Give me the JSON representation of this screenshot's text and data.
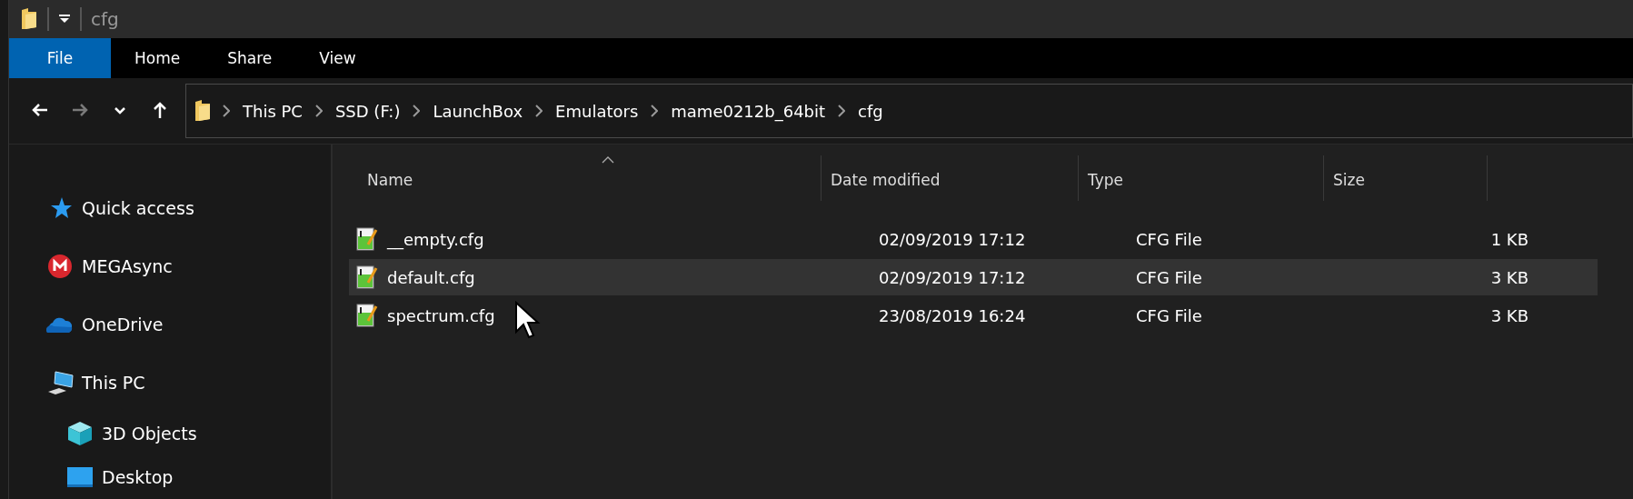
{
  "window": {
    "title": "cfg"
  },
  "ribbon_tabs": [
    {
      "label": "File",
      "kind": "file-menu"
    },
    {
      "label": "Home",
      "kind": "tab"
    },
    {
      "label": "Share",
      "kind": "tab"
    },
    {
      "label": "View",
      "kind": "tab"
    }
  ],
  "nav_buttons": [
    {
      "kind": "back",
      "disabled": false
    },
    {
      "kind": "forward",
      "disabled": true
    },
    {
      "kind": "recent",
      "disabled": false
    },
    {
      "kind": "up",
      "disabled": false
    }
  ],
  "breadcrumb": [
    "This PC",
    "SSD (F:)",
    "LaunchBox",
    "Emulators",
    "mame0212b_64bit",
    "cfg"
  ],
  "sidebar": {
    "items": [
      {
        "label": "Quick access",
        "kind": "star"
      },
      {
        "label": "MEGAsync",
        "kind": "mega"
      },
      {
        "label": "OneDrive",
        "kind": "cloud"
      },
      {
        "label": "This PC",
        "kind": "computer",
        "children": [
          {
            "label": "3D Objects",
            "kind": "cube"
          },
          {
            "label": "Desktop",
            "kind": "desktop"
          }
        ]
      }
    ]
  },
  "table": {
    "columns": [
      {
        "label": "Name",
        "sorted": true
      },
      {
        "label": "Date modified",
        "sorted": false
      },
      {
        "label": "Type",
        "sorted": false
      },
      {
        "label": "Size",
        "sorted": false
      }
    ],
    "rows": [
      {
        "name": "__empty.cfg",
        "date": "02/09/2019 17:12",
        "type": "CFG File",
        "size": "1 KB",
        "hovered": false
      },
      {
        "name": "default.cfg",
        "date": "02/09/2019 17:12",
        "type": "CFG File",
        "size": "3 KB",
        "hovered": true
      },
      {
        "name": "spectrum.cfg",
        "date": "23/08/2019 16:24",
        "type": "CFG File",
        "size": "3 KB",
        "hovered": false
      }
    ]
  }
}
